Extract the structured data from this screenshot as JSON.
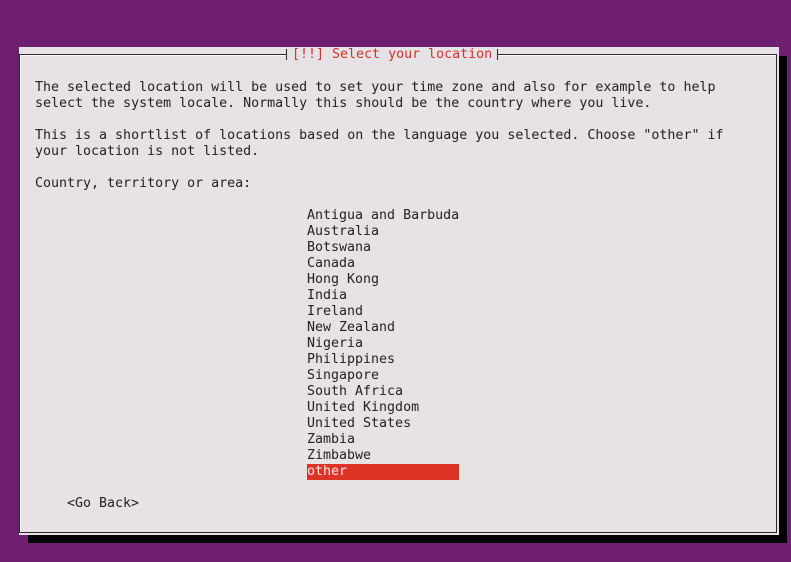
{
  "dialog": {
    "title": "[!!] Select your location",
    "intro_line1": "The selected location will be used to set your time zone and also for example to help",
    "intro_line2": "select the system locale. Normally this should be the country where you live.",
    "shortlist_line1": "This is a shortlist of locations based on the language you selected. Choose \"other\" if",
    "shortlist_line2": "your location is not listed.",
    "prompt": "Country, territory or area:",
    "selected_index": 16,
    "locations": [
      "Antigua and Barbuda",
      "Australia",
      "Botswana",
      "Canada",
      "Hong Kong",
      "India",
      "Ireland",
      "New Zealand",
      "Nigeria",
      "Philippines",
      "Singapore",
      "South Africa",
      "United Kingdom",
      "United States",
      "Zambia",
      "Zimbabwe",
      "other"
    ],
    "go_back_label": "<Go Back>"
  },
  "colors": {
    "background": "#6f1f6f",
    "dialog_bg": "#e6e2e5",
    "accent": "#dd3326",
    "title_text": "#d6322a"
  }
}
